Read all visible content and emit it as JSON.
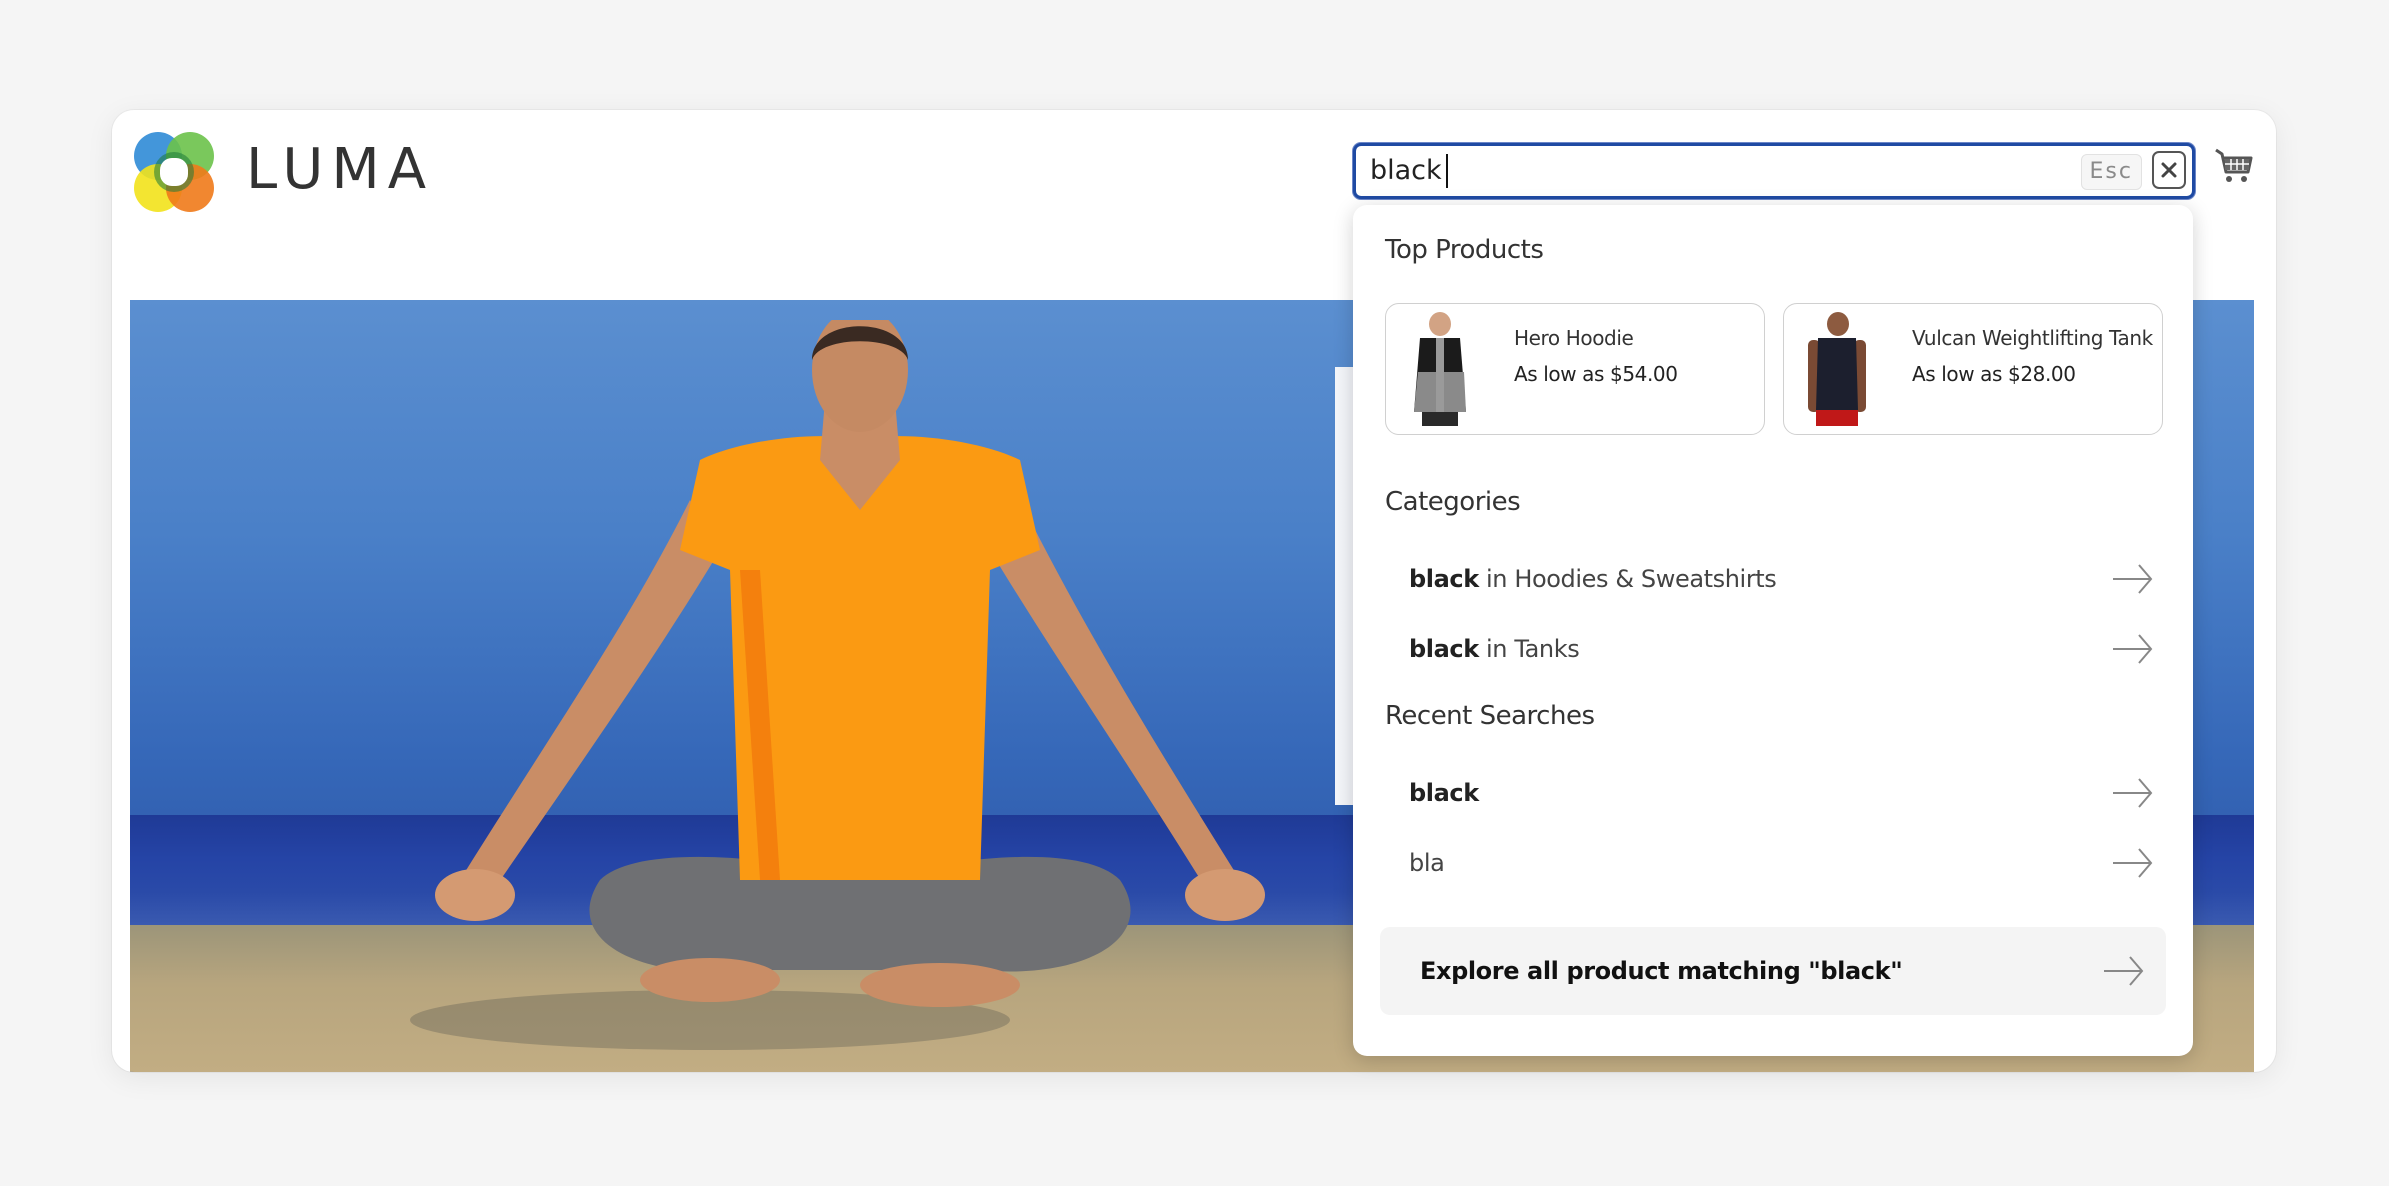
{
  "header": {
    "brand": "LUMA",
    "logo_icon": "luma-logo-icon",
    "cart_icon": "shopping-cart-icon"
  },
  "search": {
    "value": "black",
    "placeholder": "",
    "esc_label": "Esc",
    "clear_icon": "close-icon",
    "accent_color": "#1f4aa3"
  },
  "hero": {
    "image_description": "Woman in orange top meditating in lotus pose on a beach",
    "image_icon": "hero-image"
  },
  "dropdown": {
    "top_products": {
      "title": "Top Products",
      "items": [
        {
          "name": "Hero Hoodie",
          "price": "As low as $54.00",
          "thumb_icon": "hoodie-thumbnail"
        },
        {
          "name": "Vulcan Weightlifting Tank",
          "price": "As low as $28.00",
          "thumb_icon": "tank-thumbnail"
        }
      ]
    },
    "categories": {
      "title": "Categories",
      "items": [
        {
          "match": "black",
          "suffix": " in Hoodies & Sweatshirts"
        },
        {
          "match": "black",
          "suffix": " in Tanks"
        }
      ]
    },
    "recent_searches": {
      "title": "Recent Searches",
      "items": [
        {
          "match": "black",
          "suffix": ""
        },
        {
          "match": "",
          "suffix": "bla"
        }
      ]
    },
    "explore": {
      "label": "Explore all product matching \"black\""
    },
    "arrow_icon": "arrow-right-icon"
  }
}
